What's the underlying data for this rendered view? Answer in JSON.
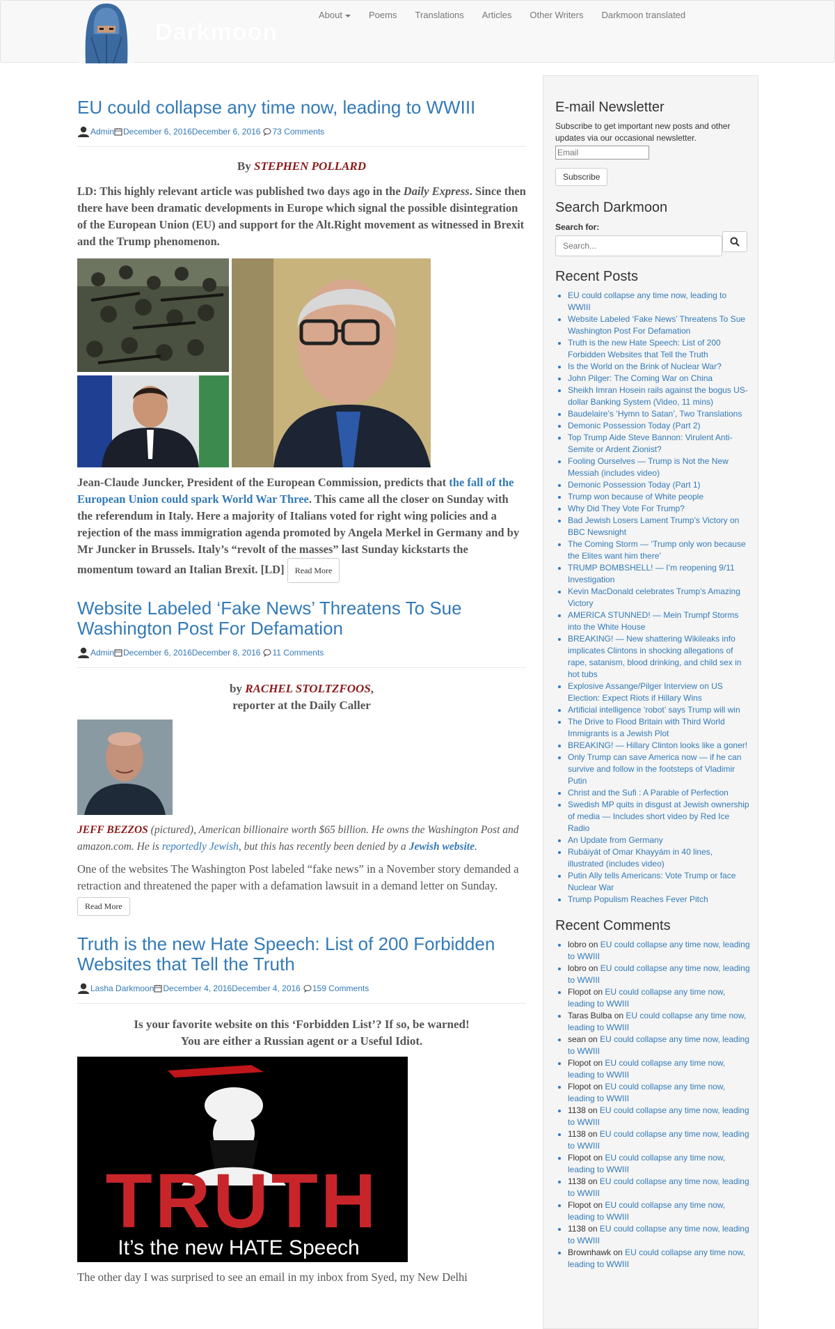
{
  "nav": {
    "brand": "Darkmoon",
    "items": [
      "About",
      "Poems",
      "Translations",
      "Articles",
      "Other Writers",
      "Darkmoon translated"
    ]
  },
  "posts": [
    {
      "title": "EU could collapse any time now, leading to WWIII",
      "author": "Admin",
      "date": "December 6, 2016",
      "updated": "December 6, 2016",
      "comments": "73 Comments",
      "by_prefix": "By",
      "by_name": "STEPHEN POLLARD",
      "intro_a": "LD:  This highly relevant article was published two days ago in the ",
      "intro_em": "Daily Express",
      "intro_b": ". Since then there have been dramatic developments in Europe which signal the possible disintegration of the European Union (EU) and support for the Alt.Right movement as witnessed in Brexit and the Trump phenomenon.",
      "body_a": "Jean-Claude Juncker, President of the European Commission, predicts that ",
      "body_link": "the fall of the European Union could spark World War Three",
      "body_b": ". This came all the closer on Sunday with the referendum in Italy. Here a majority of Italians voted for right wing policies and a rejection of the mass immigration agenda promoted by Angela Merkel in Germany and by Mr Juncker in Brussels. Italy’s “revolt of the masses” last Sunday kickstarts the momentum toward an Italian Brexit. [LD]",
      "read_more": "Read More"
    },
    {
      "title": "Website Labeled ‘Fake News’ Threatens To Sue Washington Post For Defamation",
      "author": "Admin",
      "date": "December 6, 2016",
      "updated": "December 8, 2016",
      "comments": "11 Comments",
      "by_prefix": "by",
      "by_name": "RACHEL STOLTZFOOS",
      "by_suffix": ",",
      "by_line2": "reporter at the Daily Caller",
      "caption_name": "JEFF BEZZOS",
      "caption_a": " (pictured), American billionaire worth $65 billion. He owns the Washington Post and amazon.com. He is ",
      "caption_link1": "reportedly Jewish",
      "caption_b": ", but this has recently been denied by a ",
      "caption_link2": "Jewish website",
      "caption_c": ".",
      "body": "One of the websites The Washington Post labeled “fake news” in a November story demanded a retraction and threatened the paper with a defamation lawsuit in a demand letter on Sunday.",
      "read_more": "Read More"
    },
    {
      "title": "Truth is the new Hate Speech: List of 200 Forbidden Websites that Tell the Truth",
      "author": "Lasha Darkmoon",
      "date": "December 4, 2016",
      "updated": "December 4, 2016",
      "comments": "159 Comments",
      "lead1": "Is your favorite website on this ‘Forbidden List’? If so, be warned!",
      "lead2": "You are either a Russian agent or a Useful Idiot.",
      "image_big": "TRUTH",
      "image_small": "It’s the new HATE Speech",
      "body": "The other day I was surprised to see an email in my inbox from Syed, my New Delhi"
    }
  ],
  "sidebar": {
    "newsletter": {
      "title": "E-mail Newsletter",
      "text": "Subscribe to get important new posts and other updates via our occasional newsletter.",
      "email_placeholder": "Email",
      "button": "Subscribe"
    },
    "search": {
      "title": "Search Darkmoon",
      "label": "Search for:",
      "placeholder": "Search..."
    },
    "recent_posts": {
      "title": "Recent Posts",
      "items": [
        "EU could collapse any time now, leading to WWIII",
        "Website Labeled ‘Fake News’ Threatens To Sue Washington Post For Defamation",
        "Truth is the new Hate Speech: List of 200 Forbidden Websites that Tell the Truth",
        "Is the World on the Brink of Nuclear War?",
        "John Pilger: The Coming War on China",
        "Sheikh Imran Hosein rails against the bogus US-dollar Banking System (Video, 11 mins)",
        "Baudelaire’s ‘Hymn to Satan’, Two Translations",
        "Demonic Possession Today (Part 2)",
        "Top Trump Aide Steve Bannon: Virulent Anti-Semite or Ardent Zionist?",
        "Fooling Ourselves — Trump is Not the New Messiah (includes video)",
        "Demonic Possession Today (Part 1)",
        "Trump won because of White people",
        "Why Did They Vote For Trump?",
        "Bad Jewish Losers Lament Trump’s Victory on BBC Newsnight",
        "The Coming Storm — ‘Trump only won because the Elites want him there’",
        "TRUMP BOMBSHELL! — I’m reopening 9/11 Investigation",
        "Kevin MacDonald celebrates Trump’s Amazing Victory",
        "AMERICA STUNNED! — Mein Trumpf Storms into the White House",
        "BREAKING! — New shattering Wikileaks info implicates Clintons in shocking allegations of rape, satanism, blood drinking, and child sex in hot tubs",
        "Explosive Assange/Pilger Interview on US Election: Expect Riots if Hillary Wins",
        "Artificial intelligence ‘robot’ says Trump will win",
        "The Drive to Flood Britain with Third World Immigrants is a Jewish Plot",
        "BREAKING! — Hillary Clinton looks like a goner!",
        "Only Trump can save America now — if he can survive and follow in the footsteps of Vladimir Putin",
        "Christ and the Sufi : A Parable of Perfection",
        "Swedish MP quits in disgust at Jewish ownership of media — Includes short video by Red Ice Radio",
        "An Update from Germany",
        "Rubáiyát of Omar Khayyám in 40 lines, illustrated (includes video)",
        "Putin Ally tells Americans: Vote Trump or face Nuclear War",
        "Trump Populism Reaches Fever Pitch"
      ]
    },
    "recent_comments": {
      "title": "Recent Comments",
      "on_word": "on",
      "items": [
        {
          "who": "lobro",
          "post": "EU could collapse any time now, leading to WWIII"
        },
        {
          "who": "lobro",
          "post": "EU could collapse any time now, leading to WWIII"
        },
        {
          "who": "Flopot",
          "post": "EU could collapse any time now, leading to WWIII"
        },
        {
          "who": "Taras Bulba",
          "post": "EU could collapse any time now, leading to WWIII"
        },
        {
          "who": "sean",
          "post": "EU could collapse any time now, leading to WWIII"
        },
        {
          "who": "Flopot",
          "post": "EU could collapse any time now, leading to WWIII"
        },
        {
          "who": "Flopot",
          "post": "EU could collapse any time now, leading to WWIII"
        },
        {
          "who": "1138",
          "post": "EU could collapse any time now, leading to WWIII"
        },
        {
          "who": "1138",
          "post": "EU could collapse any time now, leading to WWIII"
        },
        {
          "who": "Flopot",
          "post": "EU could collapse any time now, leading to WWIII"
        },
        {
          "who": "1138",
          "post": "EU could collapse any time now, leading to WWIII"
        },
        {
          "who": "Flopot",
          "post": "EU could collapse any time now, leading to WWIII"
        },
        {
          "who": "1138",
          "post": "EU could collapse any time now, leading to WWIII"
        },
        {
          "who": "Brownhawk",
          "post": "EU could collapse any time now, leading to WWIII"
        }
      ]
    }
  },
  "colors": {
    "link": "#337ab7",
    "author_red": "#8b1a1a",
    "navbar_bg": "#f8f8f8",
    "sidebar_bg": "#f5f5f5"
  }
}
